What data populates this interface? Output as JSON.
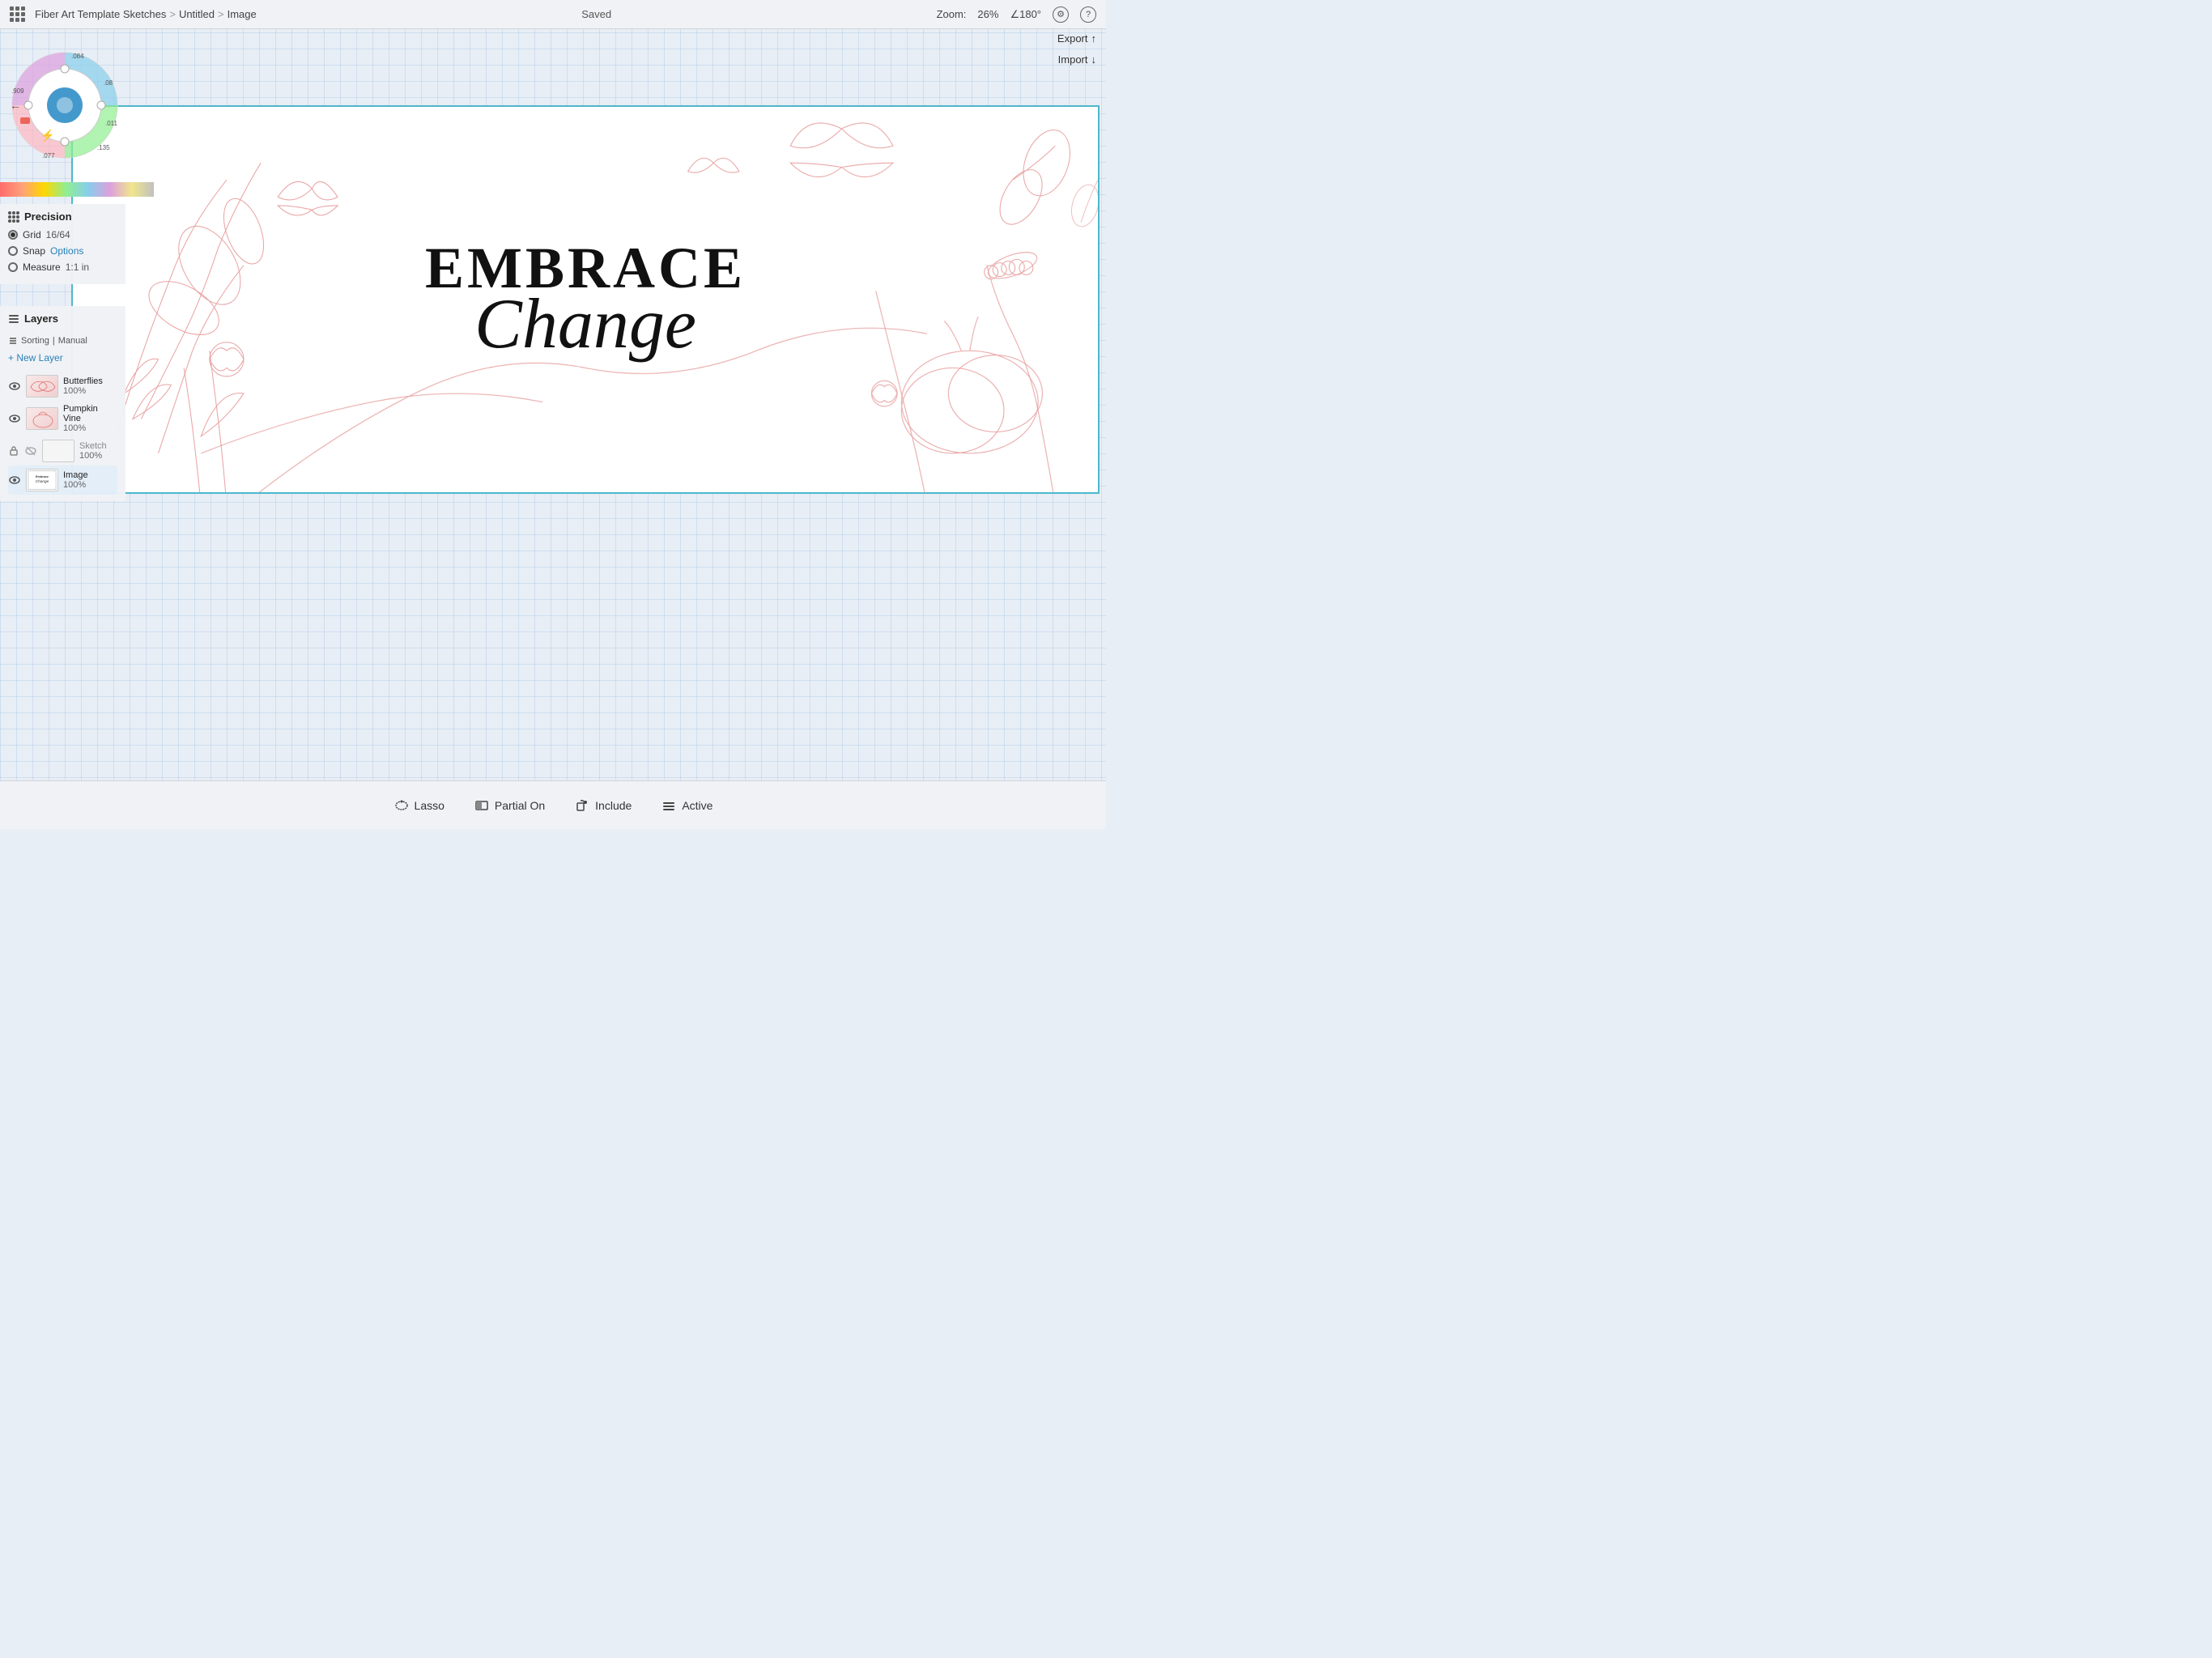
{
  "header": {
    "breadcrumb": {
      "project": "Fiber Art Template Sketches",
      "file": "Untitled",
      "layer": "Image"
    },
    "status": "Saved",
    "zoom_label": "Zoom:",
    "zoom_value": "26%",
    "rotation_label": "∠180°",
    "gear_icon": "⚙",
    "help_icon": "?"
  },
  "top_right": {
    "export_label": "Export",
    "import_label": "Import"
  },
  "precision": {
    "title": "Precision",
    "grid_label": "Grid",
    "grid_value": "16/64",
    "snap_label": "Snap",
    "snap_options": "Options",
    "measure_label": "Measure",
    "measure_value": "1:1 in"
  },
  "layers": {
    "title": "Layers",
    "sorting_label": "Sorting",
    "sorting_value": "Manual",
    "new_layer_label": "+ New Layer",
    "items": [
      {
        "name": "Butterflies",
        "opacity": "100%",
        "visible": true,
        "locked": false
      },
      {
        "name": "Pumpkin Vine",
        "opacity": "100%",
        "visible": true,
        "locked": false
      },
      {
        "name": "Sketch",
        "opacity": "100%",
        "visible": false,
        "locked": true
      },
      {
        "name": "Image",
        "opacity": "100%",
        "visible": true,
        "locked": false,
        "active": true
      }
    ]
  },
  "artwork": {
    "title_line1": "Embrace",
    "title_line2": "Change"
  },
  "bottom_toolbar": {
    "lasso_label": "Lasso",
    "partial_on_label": "Partial On",
    "include_label": "Include",
    "active_label": "Active"
  },
  "color_wheel": {
    "values": [
      ".084",
      ".909",
      ".08",
      ".011",
      ".135",
      ".077"
    ]
  }
}
